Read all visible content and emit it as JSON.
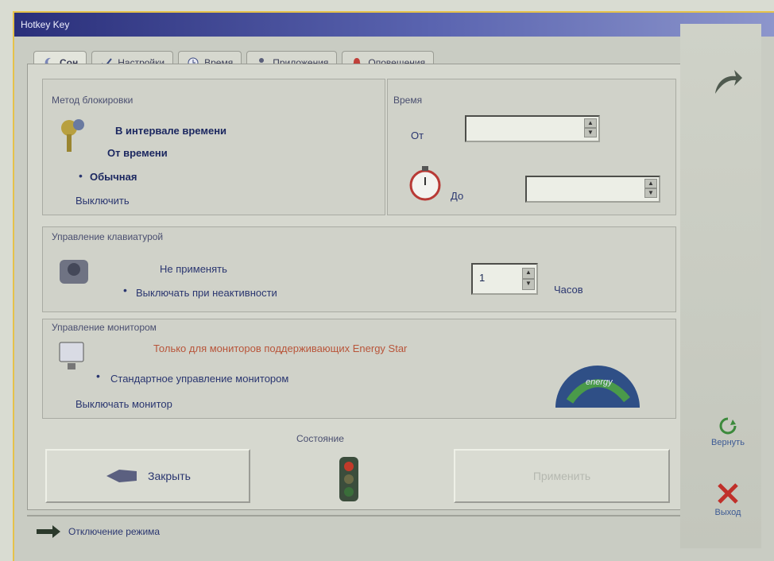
{
  "window": {
    "title": "Hotkey Key"
  },
  "tabs": [
    {
      "label": "Сон",
      "icon": "moon-icon"
    },
    {
      "label": "Настройки",
      "icon": "checkmark-icon"
    },
    {
      "label": "Время",
      "icon": "clock-icon"
    },
    {
      "label": "Приложения",
      "icon": "person-icon"
    },
    {
      "label": "Оповещения",
      "icon": "bell-icon"
    }
  ],
  "lock_mode": {
    "title": "Метод блокировки",
    "options": [
      "В интервале времени",
      "От времени",
      "Обычная",
      "Выключить"
    ],
    "selected": "Обычная"
  },
  "time": {
    "title": "Время",
    "from_label": "От",
    "from_value": "",
    "to_label": "До",
    "to_value": ""
  },
  "keyboard": {
    "title": "Управление клавиатурой",
    "options": [
      "Не применять",
      "Выключать при неактивности"
    ],
    "selected": "Выключать при неактивности",
    "hours_value": "1",
    "hours_label": "Часов"
  },
  "monitor": {
    "title": "Управление монитором",
    "note": "Только для мониторов поддерживающих Energy Star",
    "options": [
      "Стандартное управление монитором",
      "Выключать монитор"
    ],
    "selected": "Стандартное управление монитором",
    "energy_badge": "energy"
  },
  "state": {
    "label": "Состояние"
  },
  "buttons": {
    "close": "Закрыть",
    "apply": "Применить"
  },
  "statusbar": {
    "text": "Отключение режима"
  },
  "sidebar": {
    "back": "Вернуть",
    "exit": "Выход"
  },
  "colors": {
    "accent": "#2a3670",
    "warning": "#b8553a",
    "title_bar": "#2a2f7a"
  }
}
